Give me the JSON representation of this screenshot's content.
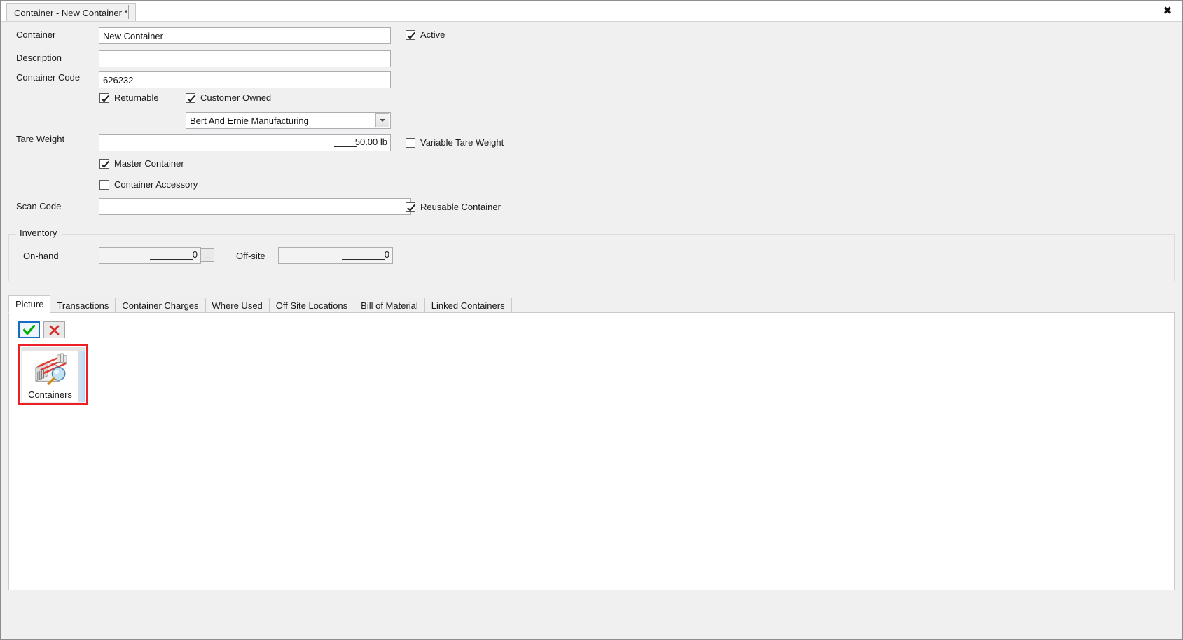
{
  "window": {
    "tab_title": "Container - New Container *",
    "close_label": "✖"
  },
  "form": {
    "container": {
      "label": "Container",
      "value": "New Container"
    },
    "description": {
      "label": "Description",
      "value": "",
      "placeholder": ""
    },
    "container_code": {
      "label": "Container Code",
      "value": "626232"
    },
    "tare_weight": {
      "label": "Tare Weight",
      "value": "50.00 lb"
    },
    "scan_code": {
      "label": "Scan Code",
      "value": "",
      "placeholder": ""
    },
    "customer": {
      "value": "Bert And Ernie Manufacturing"
    },
    "checkboxes": {
      "active": {
        "label": "Active",
        "checked": true
      },
      "returnable": {
        "label": "Returnable",
        "checked": true
      },
      "customer_owned": {
        "label": "Customer Owned",
        "checked": true
      },
      "variable_tare_weight": {
        "label": "Variable Tare Weight",
        "checked": false
      },
      "master_container": {
        "label": "Master Container",
        "checked": true
      },
      "container_accessory": {
        "label": "Container Accessory",
        "checked": false
      },
      "reusable_container": {
        "label": "Reusable Container",
        "checked": true
      }
    },
    "inventory": {
      "title": "Inventory",
      "on_hand": {
        "label": "On-hand",
        "value": "0",
        "ellipsis_label": "..."
      },
      "off_site": {
        "label": "Off-site",
        "value": "0"
      }
    }
  },
  "tabs": {
    "items": [
      {
        "label": "Picture",
        "active": true
      },
      {
        "label": "Transactions",
        "active": false
      },
      {
        "label": "Container Charges",
        "active": false
      },
      {
        "label": "Where Used",
        "active": false
      },
      {
        "label": "Off Site Locations",
        "active": false
      },
      {
        "label": "Bill of Material",
        "active": false
      },
      {
        "label": "Linked Containers",
        "active": false
      }
    ]
  },
  "picture_tab": {
    "accept_label": "✓",
    "delete_label": "✕",
    "tile_caption": "Containers"
  },
  "colors": {
    "accent_blue": "#1569c7",
    "selection_red": "#ec2024",
    "check_green": "#00b000",
    "delete_red": "#d92b2b",
    "window_bg": "#f0f0f0",
    "field_bg": "#ffffff",
    "field_border": "#abadb3"
  }
}
